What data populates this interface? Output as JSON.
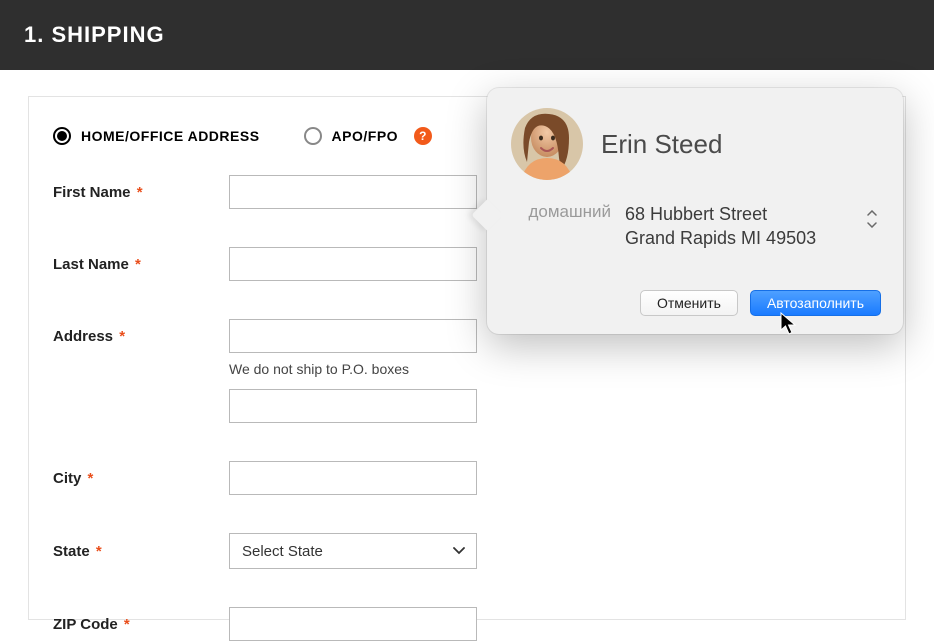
{
  "header": {
    "title": "1. SHIPPING"
  },
  "address_type": {
    "home_office": {
      "label": "HOME/OFFICE ADDRESS",
      "selected": true
    },
    "apo_fpo": {
      "label": "APO/FPO",
      "selected": false
    },
    "help_glyph": "?"
  },
  "form": {
    "first_name": {
      "label": "First Name",
      "required": "*",
      "value": ""
    },
    "last_name": {
      "label": "Last Name",
      "required": "*",
      "value": ""
    },
    "address": {
      "label": "Address",
      "required": "*",
      "value": "",
      "hint": "We do not ship to P.O. boxes"
    },
    "address2": {
      "value": ""
    },
    "city": {
      "label": "City",
      "required": "*",
      "value": ""
    },
    "state": {
      "label": "State",
      "required": "*",
      "placeholder": "Select State"
    },
    "zip": {
      "label": "ZIP Code",
      "required": "*",
      "value": ""
    }
  },
  "autofill": {
    "contact_name": "Erin Steed",
    "address_type_label": "домашний",
    "address_line1": "68 Hubbert Street",
    "address_line2": "Grand Rapids MI 49503",
    "cancel_label": "Отменить",
    "fill_label": "Автозаполнить"
  }
}
